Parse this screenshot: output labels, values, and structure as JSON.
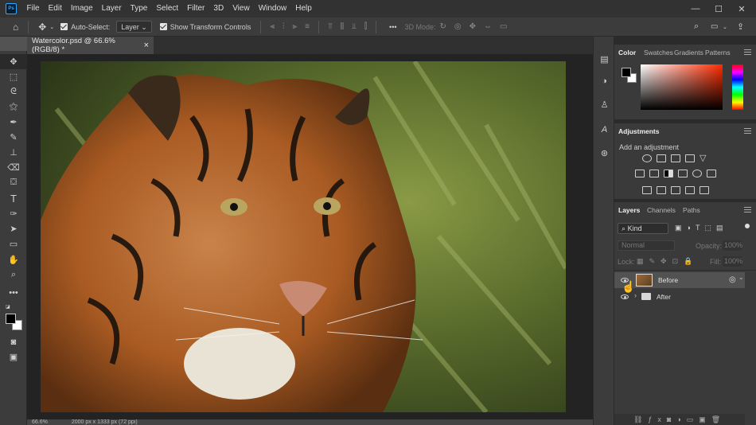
{
  "menu": {
    "items": [
      "File",
      "Edit",
      "Image",
      "Layer",
      "Type",
      "Select",
      "Filter",
      "3D",
      "View",
      "Window",
      "Help"
    ],
    "logo_text": "Ps"
  },
  "window_controls": {
    "minimize": "—",
    "maximize": "☐",
    "close": "✕"
  },
  "options_bar": {
    "auto_select_label": "Auto-Select:",
    "auto_select_value": "Layer",
    "show_transform_label": "Show Transform Controls",
    "mode_label": "3D Mode:",
    "more_label": "•••"
  },
  "document": {
    "tab_title": "Watercolor.psd @ 66.6% (RGB/8) *",
    "close_label": "×",
    "zoom": "66.6%",
    "dimensions": "2000 px x 1333 px (72 ppi)"
  },
  "color_panel": {
    "tabs": [
      "Color",
      "Swatches",
      "Gradients",
      "Patterns"
    ],
    "foreground": "#000000",
    "background": "#ffffff"
  },
  "adjustments_panel": {
    "title": "Adjustments",
    "subtitle": "Add an adjustment"
  },
  "layers_panel": {
    "tabs": [
      "Layers",
      "Channels",
      "Paths"
    ],
    "filter_value": "Kind",
    "blend_mode": "Normal",
    "opacity_label": "Opacity:",
    "opacity_value": "100%",
    "lock_label": "Lock:",
    "fill_label": "Fill:",
    "fill_value": "100%",
    "layers": [
      {
        "name": "Before",
        "type": "smart-object",
        "visible": true,
        "selected": true
      },
      {
        "name": "After",
        "type": "group",
        "visible": true,
        "selected": false
      }
    ]
  },
  "colors": {
    "accent": "#31a8ff",
    "app_bg": "#535353",
    "panel_bg": "#3a3a3a"
  }
}
